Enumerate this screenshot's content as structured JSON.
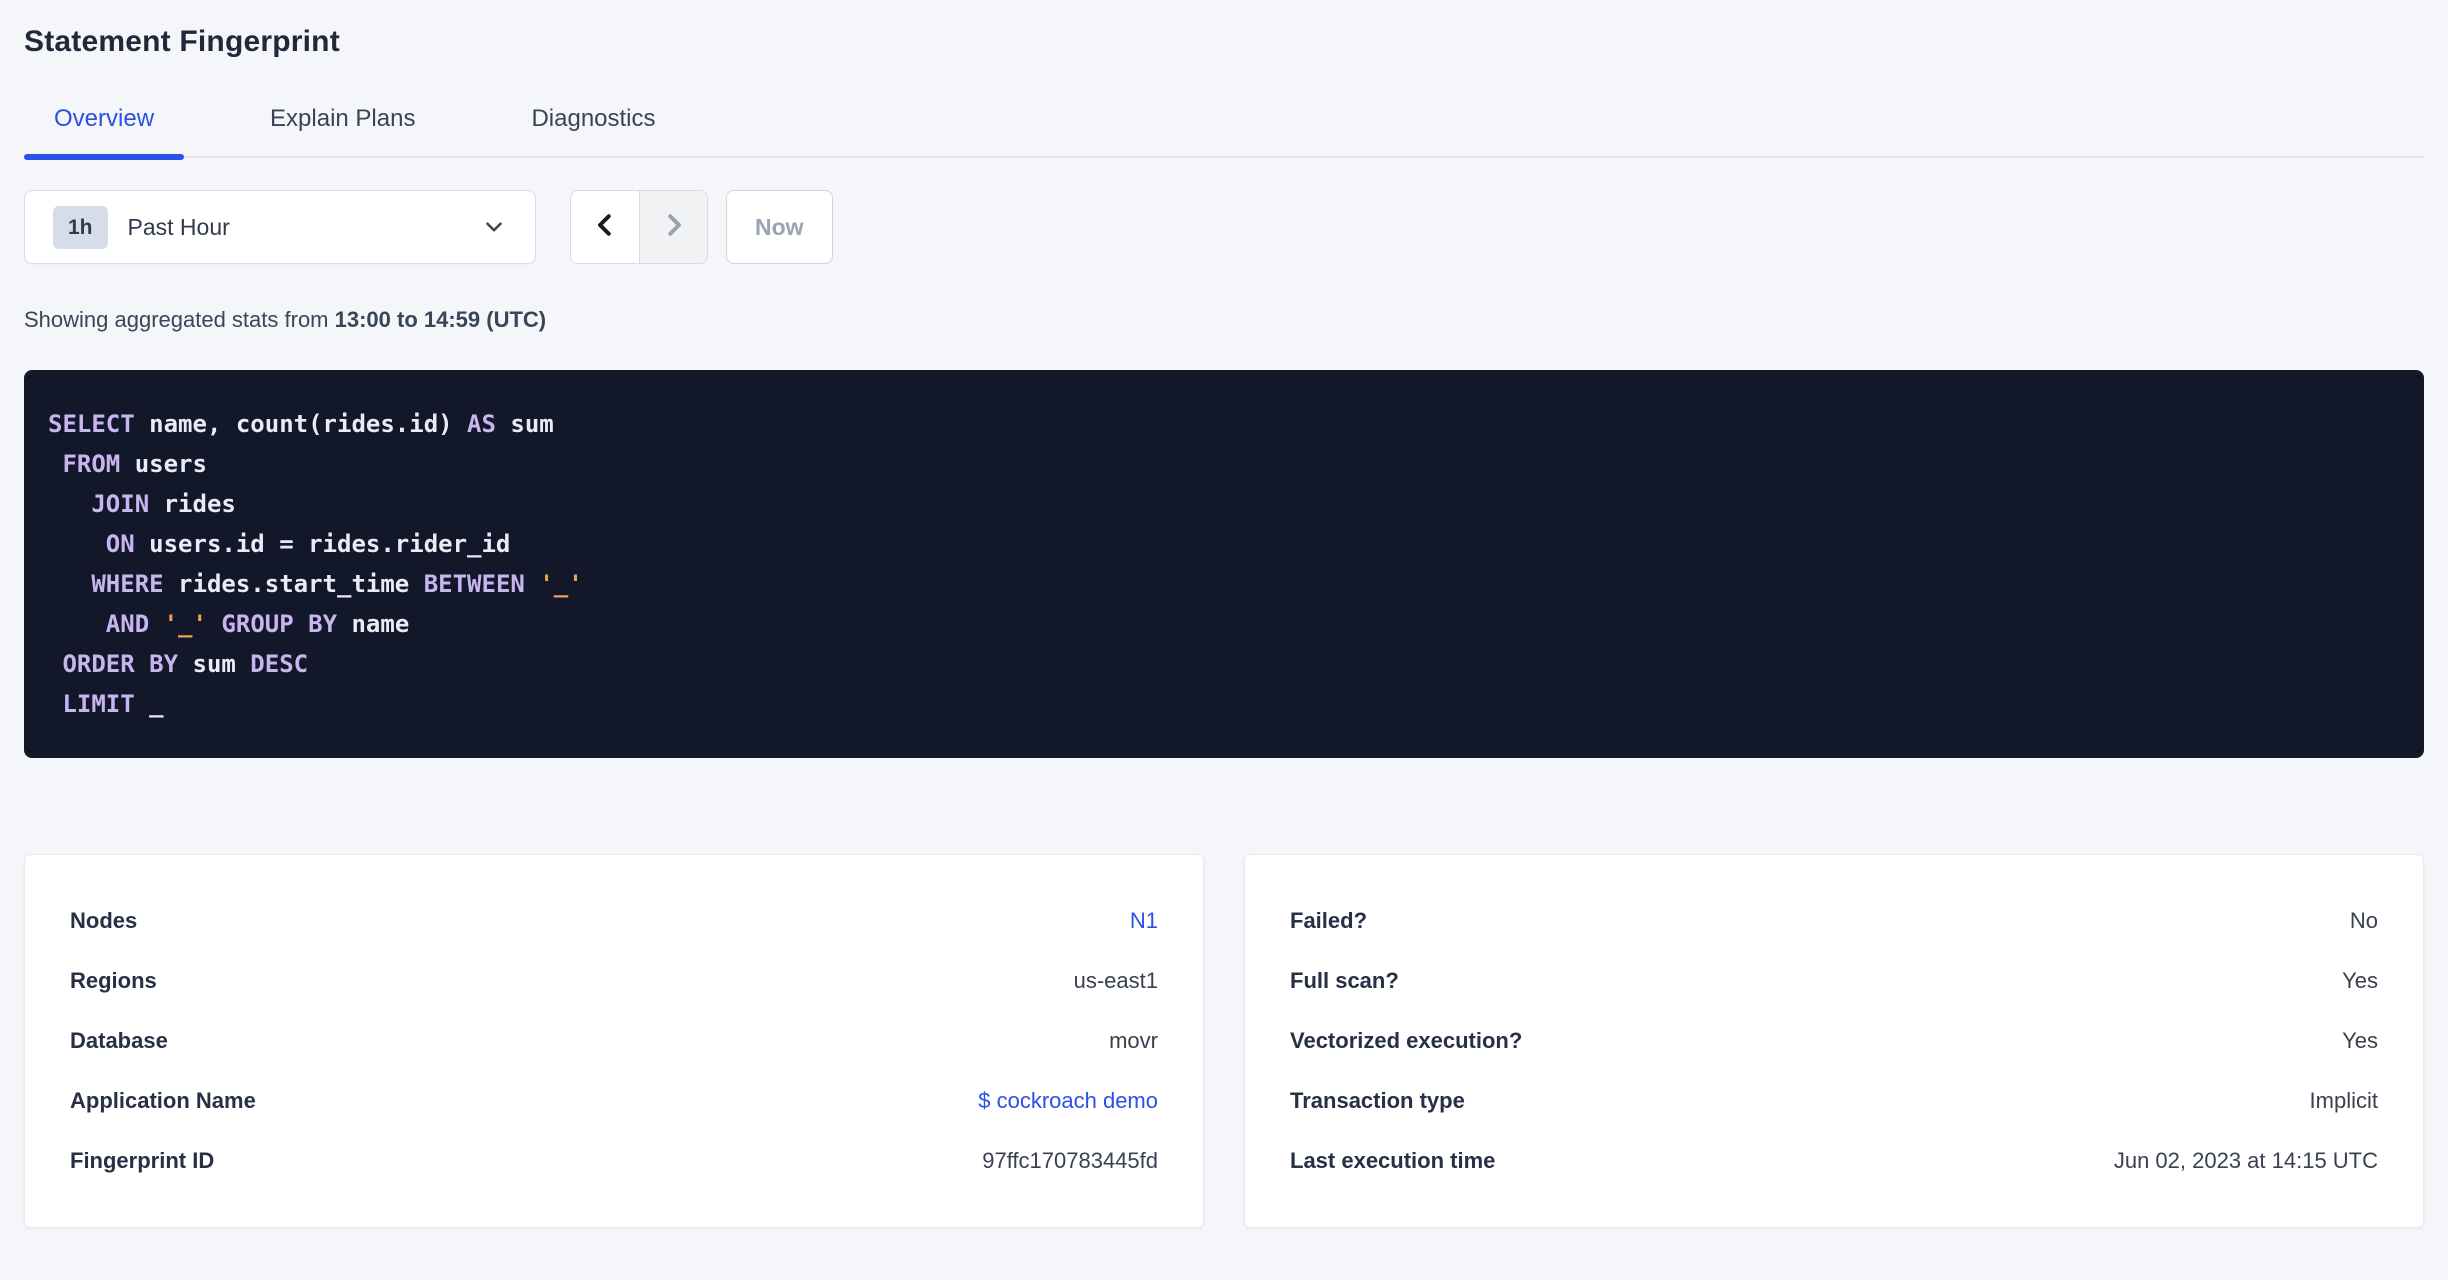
{
  "page": {
    "title": "Statement Fingerprint"
  },
  "tabs": [
    {
      "label": "Overview",
      "active": true
    },
    {
      "label": "Explain Plans",
      "active": false
    },
    {
      "label": "Diagnostics",
      "active": false
    }
  ],
  "time_controls": {
    "interval_badge": "1h",
    "range_label": "Past Hour",
    "now_label": "Now"
  },
  "stats_line": {
    "prefix": "Showing aggregated stats from ",
    "range_bold": "13:00 to 14:59 (UTC)"
  },
  "sql": {
    "lines": [
      [
        {
          "t": "kw",
          "v": "SELECT"
        },
        {
          "t": "txt",
          "v": " name, count(rides.id) "
        },
        {
          "t": "kw",
          "v": "AS"
        },
        {
          "t": "txt",
          "v": " sum"
        }
      ],
      [
        {
          "t": "txt",
          "v": " "
        },
        {
          "t": "kw",
          "v": "FROM"
        },
        {
          "t": "txt",
          "v": " users"
        }
      ],
      [
        {
          "t": "txt",
          "v": "   "
        },
        {
          "t": "kw",
          "v": "JOIN"
        },
        {
          "t": "txt",
          "v": " rides"
        }
      ],
      [
        {
          "t": "txt",
          "v": "    "
        },
        {
          "t": "kw",
          "v": "ON"
        },
        {
          "t": "txt",
          "v": " users.id = rides.rider_id"
        }
      ],
      [
        {
          "t": "txt",
          "v": "   "
        },
        {
          "t": "kw",
          "v": "WHERE"
        },
        {
          "t": "txt",
          "v": " rides.start_time "
        },
        {
          "t": "kw",
          "v": "BETWEEN"
        },
        {
          "t": "txt",
          "v": " "
        },
        {
          "t": "str",
          "v": "'_'"
        }
      ],
      [
        {
          "t": "txt",
          "v": "    "
        },
        {
          "t": "kw",
          "v": "AND"
        },
        {
          "t": "txt",
          "v": " "
        },
        {
          "t": "str",
          "v": "'_'"
        },
        {
          "t": "txt",
          "v": " "
        },
        {
          "t": "kw",
          "v": "GROUP BY"
        },
        {
          "t": "txt",
          "v": " name"
        }
      ],
      [
        {
          "t": "txt",
          "v": " "
        },
        {
          "t": "kw",
          "v": "ORDER BY"
        },
        {
          "t": "txt",
          "v": " sum "
        },
        {
          "t": "kw",
          "v": "DESC"
        }
      ],
      [
        {
          "t": "txt",
          "v": " "
        },
        {
          "t": "kw",
          "v": "LIMIT"
        },
        {
          "t": "txt",
          "v": " _"
        }
      ]
    ]
  },
  "details_card": {
    "rows": [
      {
        "label": "Nodes",
        "value": "N1",
        "link": true
      },
      {
        "label": "Regions",
        "value": "us-east1",
        "link": false
      },
      {
        "label": "Database",
        "value": "movr",
        "link": false
      },
      {
        "label": "Application Name",
        "value": "$ cockroach demo",
        "link": true
      },
      {
        "label": "Fingerprint ID",
        "value": "97ffc170783445fd",
        "link": false
      }
    ]
  },
  "execution_card": {
    "rows": [
      {
        "label": "Failed?",
        "value": "No",
        "link": false
      },
      {
        "label": "Full scan?",
        "value": "Yes",
        "link": false
      },
      {
        "label": "Vectorized execution?",
        "value": "Yes",
        "link": false
      },
      {
        "label": "Transaction type",
        "value": "Implicit",
        "link": false
      },
      {
        "label": "Last execution time",
        "value": "Jun 02, 2023 at 14:15 UTC",
        "link": false
      }
    ]
  },
  "colors": {
    "page_bg": "#f4f6fa",
    "accent_blue": "#2b50e6",
    "link_blue": "#2b50e6",
    "sql_background": "#121829",
    "sql_keyword": "#c8b5ef",
    "sql_string": "#efa153",
    "sql_text": "#e8ecf4"
  }
}
